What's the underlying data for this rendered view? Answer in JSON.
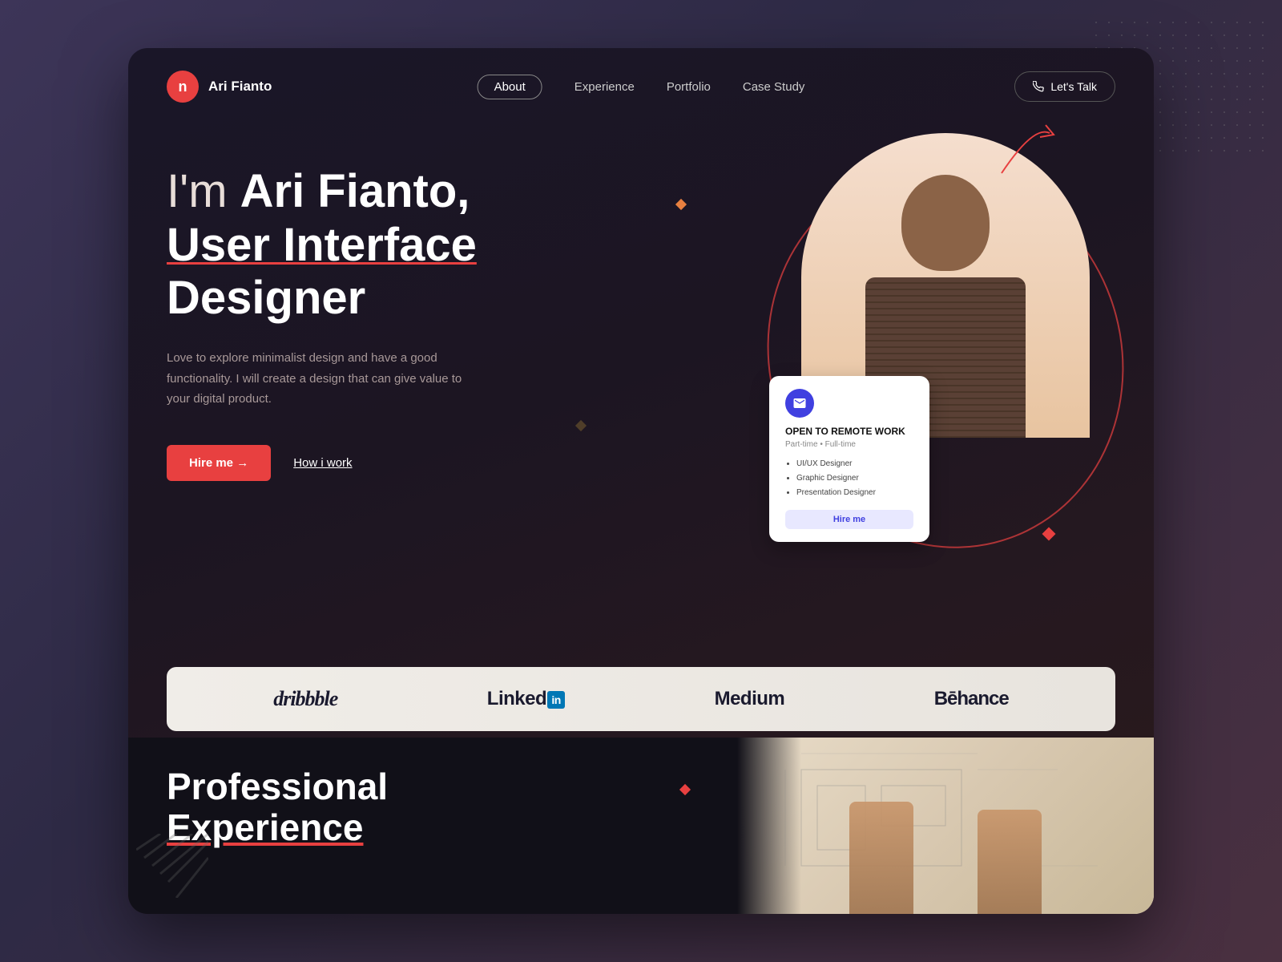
{
  "page": {
    "bg_color": "#3d3558"
  },
  "navbar": {
    "logo_letter": "n",
    "logo_name": "Ari Fianto",
    "links": [
      {
        "label": "About",
        "active": true
      },
      {
        "label": "Experience",
        "active": false
      },
      {
        "label": "Portfolio",
        "active": false
      },
      {
        "label": "Case Study",
        "active": false
      }
    ],
    "cta_label": "Let's Talk"
  },
  "hero": {
    "heading_normal": "I'm ",
    "heading_bold": "Ari Fianto,",
    "heading_line2": "User Interface",
    "heading_line3": "Designer",
    "subtitle": "Love to explore minimalist design and have a good functionality. I will create a design that can give value to your digital product.",
    "hire_btn": "Hire me →",
    "how_link": "How i work"
  },
  "card": {
    "title": "OPEN TO REMOTE WORK",
    "subtitle": "Part-time • Full-time",
    "roles": [
      "UI/UX Designer",
      "Graphic Designer",
      "Presentation Designer"
    ],
    "btn_label": "Hire me"
  },
  "brands": [
    {
      "label": "dribbble"
    },
    {
      "label": "LinkedIn"
    },
    {
      "label": "Medium"
    },
    {
      "label": "Bēhance"
    }
  ],
  "bottom": {
    "title_line1": "Professional",
    "title_line2": "Experience"
  }
}
